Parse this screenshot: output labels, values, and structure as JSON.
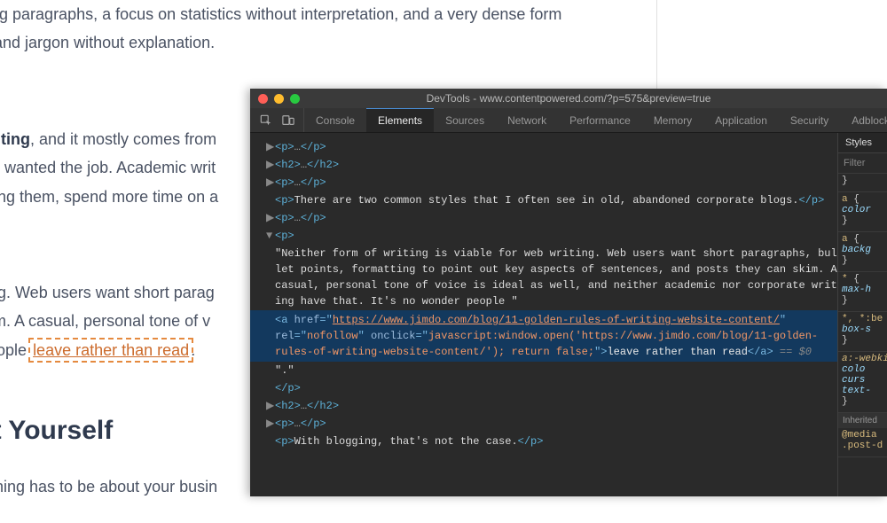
{
  "article": {
    "p1": "ry long paragraphs, a focus on statistics without interpretation, and a very dense form",
    "p2": "yms and jargon without explanation.",
    "p3_pre": "ic writing",
    "p3_mid": ", and it mostly comes from",
    "p4": "g and wanted the job. Academic writ",
    "p5": "swering them, spend more time on a",
    "p6": "writing. Web users want short parag",
    "p7": "n skim. A casual, personal tone of v",
    "p8_pre": "er people ",
    "p8_link": "leave rather than read",
    "h2": "out Yourself",
    "p9": "verything has to be about your busin"
  },
  "devtools": {
    "title": "DevTools - www.contentpowered.com/?p=575&preview=true",
    "tabs": {
      "console": "Console",
      "elements": "Elements",
      "sources": "Sources",
      "network": "Network",
      "performance": "Performance",
      "memory": "Memory",
      "application": "Application",
      "security": "Security",
      "adblock": "Adblock"
    },
    "dom": {
      "l1": "<p>…</p>",
      "l2": "<h2>…</h2>",
      "l3": "<p>…</p>",
      "l4_open": "<p>",
      "l4_text": "There are two common styles that I often see in old, abandoned corporate blogs.",
      "l4_close": "</p>",
      "l5": "<p>…</p>",
      "l6": "<p>",
      "quote": "\"Neither form of writing is viable for web writing. Web users want short paragraphs, bullet points, formatting to point out key aspects of sentences, and posts they can skim. A casual, personal tone of voice is ideal as well, and neither academic nor corporate writing have that. It's no wonder people \"",
      "a_tag": "a",
      "href_n": "href",
      "href_v": "https://www.jimdo.com/blog/11-golden-rules-of-writing-website-content/",
      "rel_n": "rel",
      "rel_v": "nofollow",
      "onclick_n": "onclick",
      "onclick_v": "javascript:window.open('https://www.jimdo.com/blog/11-golden-rules-of-writing-website-content/'); return false;",
      "link_text": "leave rather than read",
      "a_close": "</a>",
      "eq": " == $0",
      "dot": "\".\"",
      "p_close": "</p>",
      "l7": "<h2>…</h2>",
      "l8": "<p>…</p>",
      "l9_open": "<p>",
      "l9_text": "With blogging, that's not the case.",
      "l9_close": "</p>"
    },
    "styles": {
      "tab": "Styles",
      "filter": "Filter",
      "r1_sel": "a",
      "r1_prop": "color",
      "r2_sel": "a",
      "r2_prop": "backg",
      "r3_sel": "*",
      "r3_prop": "max-h",
      "r4_sel": "*, *:be",
      "r4_prop": "box-s",
      "r5_sel": "a:-webki",
      "r5_p1": "colo",
      "r5_p2": "curs",
      "r5_p3": "text-",
      "inherit": "Inherited ",
      "r6_sel": "@media ",
      "r6_sel2": ".post-d"
    }
  }
}
